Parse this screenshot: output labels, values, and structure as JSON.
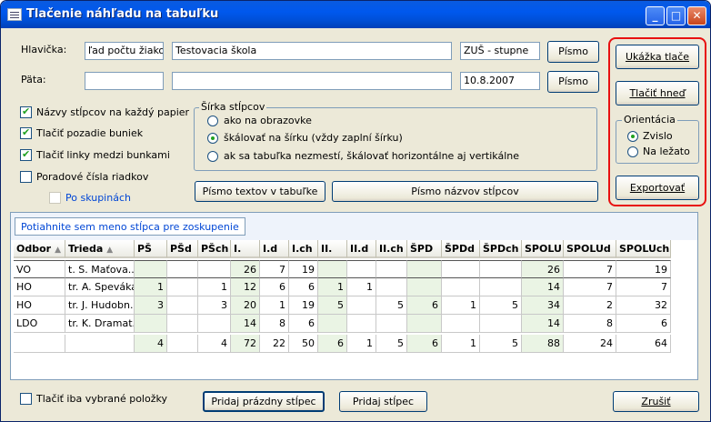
{
  "window": {
    "title": "Tlačenie náhľadu na tabuľku"
  },
  "header_fields": {
    "label": "Hlavička:",
    "left": "ľad počtu žiakov",
    "center": "Testovacia škola",
    "right": "ZUŠ - stupne",
    "font_button": "Písmo"
  },
  "footer_fields": {
    "label": "Päta:",
    "left": "",
    "center": "",
    "right": "10.8.2007",
    "font_button": "Písmo"
  },
  "options": {
    "col_names_each_page": "Názvy stĺpcov na každý papier",
    "print_cell_bg": "Tlačiť pozadie buniek",
    "print_cell_lines": "Tlačiť linky medzi bunkami",
    "row_numbers": "Poradové čísla riadkov",
    "by_groups": "Po skupinách"
  },
  "column_width": {
    "legend": "Šírka stĺpcov",
    "opt1": "ako na obrazovke",
    "opt2": "škálovať na šírku (vždy zaplní šírku)",
    "opt3": "ak sa tabuľka nezmestí, škálovať horizontálne aj vertikálne"
  },
  "font_buttons": {
    "table_text": "Písmo textov v tabuľke",
    "column_names": "Písmo názvov stĺpcov"
  },
  "actions": {
    "preview": "Ukážka tlače",
    "print_now": "Tlačiť hneď",
    "orientation_legend": "Orientácia",
    "portrait": "Zvislo",
    "landscape": "Na ležato",
    "export": "Exportovať"
  },
  "grid": {
    "group_hint": "Potiahnite sem meno stĺpca pre zoskupenie",
    "columns": [
      "Odbor",
      "Trieda",
      "PŠ",
      "PŠd",
      "PŠch",
      "I.",
      "I.d",
      "I.ch",
      "II.",
      "II.d",
      "II.ch",
      "ŠPD",
      "ŠPDd",
      "ŠPDch",
      "SPOLU",
      "SPOLUd",
      "SPOLUch"
    ],
    "rows": [
      [
        "VO",
        "t. S. Maťova...",
        "",
        "",
        "",
        "26",
        "7",
        "19",
        "",
        "",
        "",
        "",
        "",
        "",
        "26",
        "7",
        "19"
      ],
      [
        "HO",
        "tr. A. Speváka",
        "1",
        "",
        "1",
        "12",
        "6",
        "6",
        "1",
        "1",
        "",
        "",
        "",
        "",
        "14",
        "7",
        "7"
      ],
      [
        "HO",
        "tr. J. Hudobn...",
        "3",
        "",
        "3",
        "20",
        "1",
        "19",
        "5",
        "",
        "5",
        "6",
        "1",
        "5",
        "34",
        "2",
        "32"
      ],
      [
        "LDO",
        "tr. K. Dramat...",
        "",
        "",
        "",
        "14",
        "8",
        "6",
        "",
        "",
        "",
        "",
        "",
        "",
        "14",
        "8",
        "6"
      ]
    ],
    "totals": [
      "",
      "",
      "4",
      "",
      "4",
      "72",
      "22",
      "50",
      "6",
      "1",
      "5",
      "6",
      "1",
      "5",
      "88",
      "24",
      "64"
    ]
  },
  "bottom": {
    "only_selected": "Tlačiť iba vybrané položky",
    "add_empty_col": "Pridaj prázdny stĺpec",
    "add_col": "Pridaj stĺpec",
    "cancel": "Zrušiť"
  },
  "colors": {
    "accent_red": "#e81010",
    "group_blue": "#0046d5",
    "green_cells": "#eaf4e4"
  }
}
